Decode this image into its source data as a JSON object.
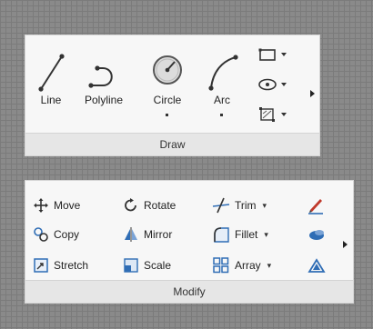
{
  "draw": {
    "title": "Draw",
    "tools": {
      "line": "Line",
      "polyline": "Polyline",
      "circle": "Circle",
      "arc": "Arc"
    }
  },
  "modify": {
    "title": "Modify",
    "tools": {
      "move": "Move",
      "rotate": "Rotate",
      "trim": "Trim",
      "copy": "Copy",
      "mirror": "Mirror",
      "fillet": "Fillet",
      "stretch": "Stretch",
      "scale": "Scale",
      "array": "Array"
    },
    "dropdown_caret": "▾"
  },
  "colors": {
    "panel": "#f7f7f7",
    "title_bar": "#e6e6e6",
    "background": "#8a8a8a",
    "accent_blue": "#2f6db5",
    "accent_red": "#c0392b"
  }
}
